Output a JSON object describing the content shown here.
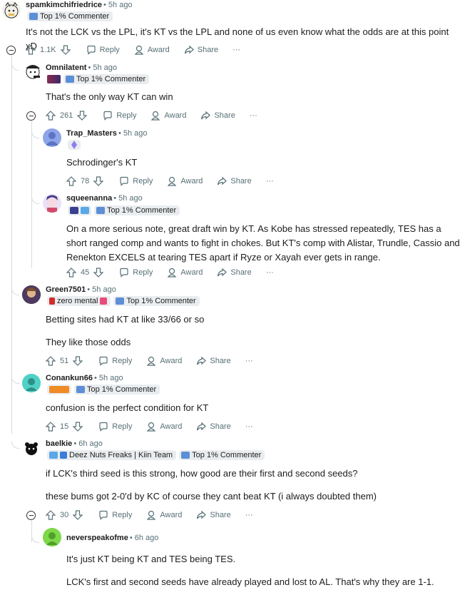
{
  "comments": [
    {
      "author": "spamkimchifriedrice",
      "time": "• 5h ago",
      "flair": "Top 1% Commenter",
      "body": [
        "It's not the LCK vs the LPL, it's KT vs the LPL and none of us even know what the odds are at this point xD"
      ],
      "votes": "1.1K"
    },
    {
      "author": "Omnilatent",
      "time": "• 5h ago",
      "flair": "Top 1% Commenter",
      "body": [
        "That's the only way KT can win"
      ],
      "votes": "261"
    },
    {
      "author": "Trap_Masters",
      "time": "• 5h ago",
      "body": [
        "Schrodinger's KT"
      ],
      "votes": "78"
    },
    {
      "author": "squeenanna",
      "time": "• 5h ago",
      "flair": "Top 1% Commenter",
      "body": [
        "On a more serious note, great draft win by KT. As Kobe has stressed repeatedly, TES has a short ranged comp and wants to fight in chokes. But KT's comp with Alistar, Trundle, Cassio and Renekton EXCELS at tearing TES apart if Ryze or Xayah ever gets in range."
      ],
      "votes": "45"
    },
    {
      "author": "Green7501",
      "time": "• 5h ago",
      "flair0": "zero mental",
      "flair": "Top 1% Commenter",
      "body": [
        "Betting sites had KT at like 33/66 or so",
        "They like those odds"
      ],
      "votes": "51"
    },
    {
      "author": "Conankun66",
      "time": "• 5h ago",
      "flair": "Top 1% Commenter",
      "body": [
        "confusion is the perfect condition for KT"
      ],
      "votes": "15"
    },
    {
      "author": "baelkie",
      "time": "• 6h ago",
      "flair0": "Deez Nuts Freaks | Kiin Team",
      "flair": "Top 1% Commenter",
      "body": [
        "if LCK's third seed is this strong, how good are their first and second seeds?",
        "these bums got 2-0'd by KC of course they cant beat KT (i always doubted them)"
      ],
      "votes": "30"
    },
    {
      "author": "neverspeakofme",
      "time": "• 6h ago",
      "body": [
        "It's just KT being KT and TES being TES.",
        "LCK's first and second seeds have already played and lost to AL. That's why they are 1-1."
      ]
    }
  ],
  "actions": {
    "reply": "Reply",
    "award": "Award",
    "share": "Share",
    "more": "···"
  },
  "colors": {
    "meta": "#576f76",
    "thread_line": "#d8dcdf",
    "flair_bg": "#eaedef"
  }
}
